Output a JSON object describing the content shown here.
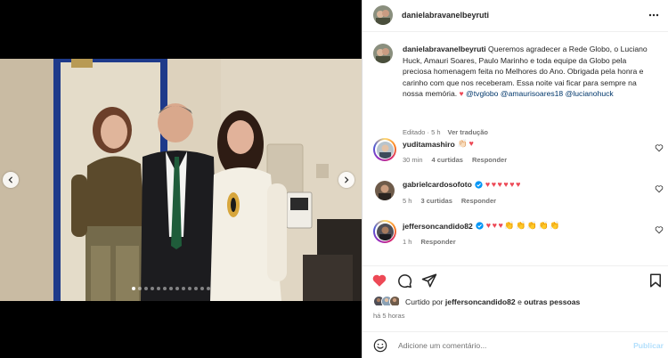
{
  "post": {
    "author": "danielabravanelbeyruti",
    "more_icon": "more-horizontal-icon"
  },
  "media": {
    "image_alt": "Three people posing together backstage",
    "carousel_count": 13,
    "carousel_active": 1
  },
  "caption": {
    "username": "danielabravanelbeyruti",
    "text": "Queremos agradecer a Rede Globo, o Luciano Huck, Amauri Soares, Paulo Marinho e toda equipe da Globo pela preciosa homenagem feita no Melhores do Ano. Obrigada pela honra e carinho com que nos receberam. Essa noite vai ficar para sempre na nossa memória.",
    "heart": "♥",
    "mentions": [
      "@tvglobo",
      "@amaurisoares18",
      "@lucianohuck"
    ],
    "meta_status": "Editado · 5 h",
    "see_translation": "Ver tradução"
  },
  "comments": [
    {
      "username": "yuditamashiro",
      "emojis": [
        "👏🏻",
        "♥"
      ],
      "time": "30 min",
      "replies": "4 curtidas",
      "reply_label": "Responder"
    },
    {
      "username": "gabrielcardosofoto",
      "verified": true,
      "emojis": [
        "♥",
        "♥",
        "♥",
        "♥",
        "♥",
        "♥"
      ],
      "time": "5 h",
      "replies": "3 curtidas",
      "reply_label": "Responder"
    },
    {
      "username": "jeffersoncandido82",
      "verified": true,
      "emojis": [
        "♥",
        "♥",
        "♥",
        "👏",
        "👏",
        "👏",
        "👏",
        "👏"
      ],
      "time": "1 h",
      "replies": "",
      "reply_label": "Responder"
    }
  ],
  "likes": {
    "prefix": "Curtido por",
    "user": "jeffersoncandido82",
    "connector": "e",
    "others": "outras pessoas"
  },
  "timestamp": "há 5 horas",
  "add_comment": {
    "placeholder": "Adicione um comentário...",
    "publish_label": "Publicar"
  },
  "colors": {
    "like_red": "#ed4956",
    "mention_blue": "#00376b",
    "verified_blue": "#0095f6",
    "publish_disabled": "#b2dffc",
    "muted_text": "#737373"
  }
}
